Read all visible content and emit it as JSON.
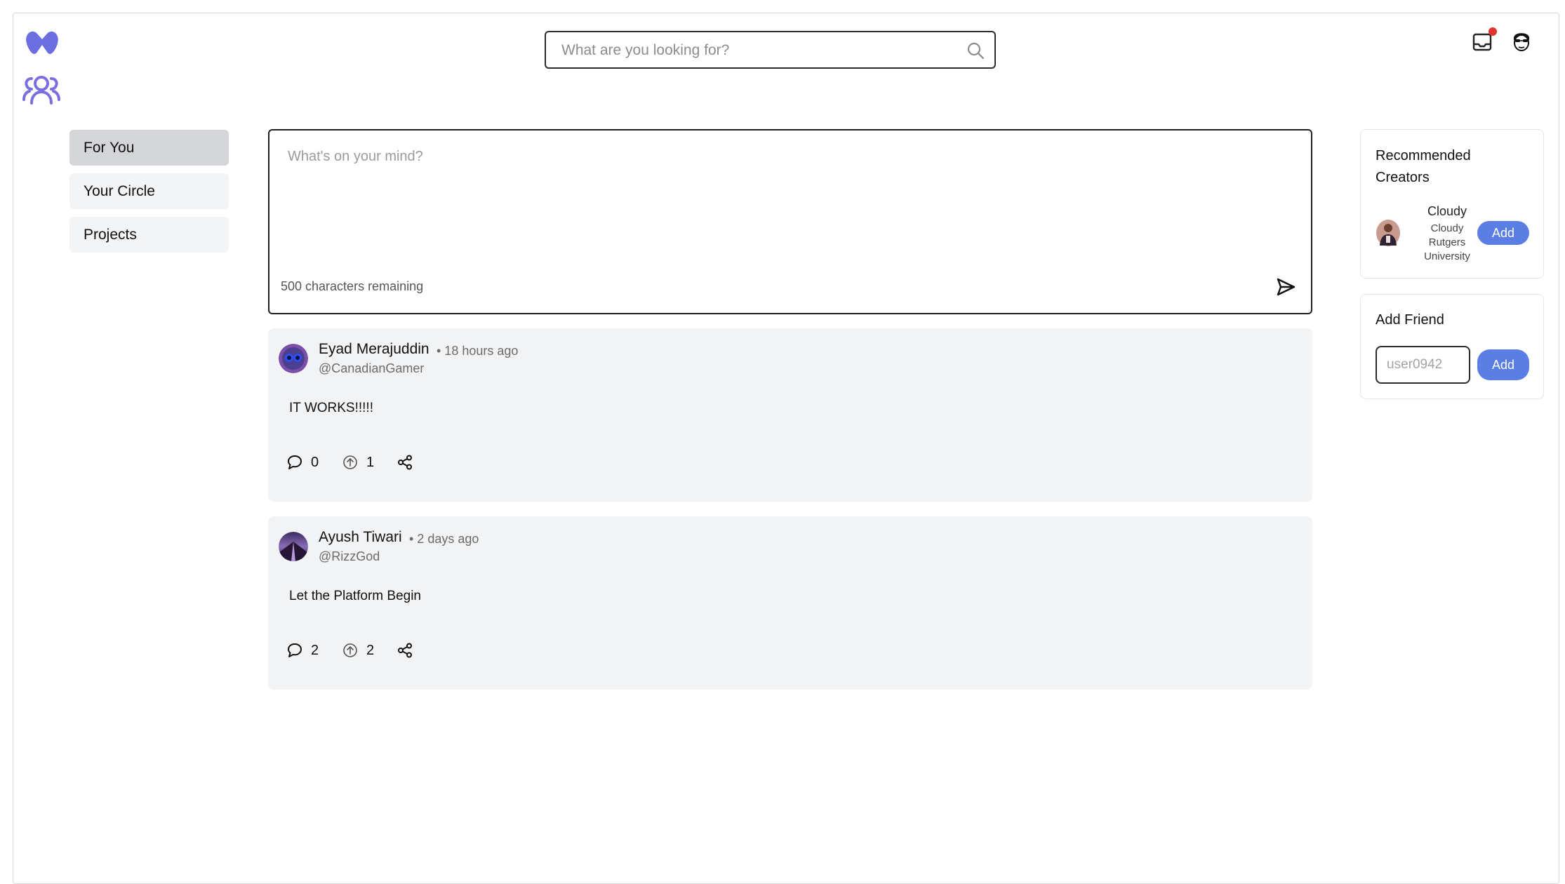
{
  "header": {
    "search": {
      "placeholder": "What are you looking for?"
    },
    "inbox_has_notification": true,
    "icons": [
      "logo-icon",
      "friends-icon",
      "search-icon",
      "inbox-icon",
      "user-avatar"
    ]
  },
  "nav": {
    "items": [
      {
        "label": "For You",
        "active": true
      },
      {
        "label": "Your Circle",
        "active": false
      },
      {
        "label": "Projects",
        "active": false
      }
    ]
  },
  "composer": {
    "placeholder": "What's on your mind?",
    "remaining": "500 characters remaining"
  },
  "posts": [
    {
      "author": "Eyad Merajuddin",
      "time": "• 18 hours ago",
      "handle": "@CanadianGamer",
      "body": "IT WORKS!!!!!",
      "comments": "0",
      "upvotes": "1"
    },
    {
      "author": "Ayush Tiwari",
      "time": "• 2 days ago",
      "handle": "@RizzGod",
      "body": "Let the Platform Begin",
      "comments": "2",
      "upvotes": "2"
    }
  ],
  "recommended": {
    "title": "Recommended Creators",
    "creators": [
      {
        "name": "Cloudy",
        "subtitle": "Cloudy",
        "school_line1": "Rutgers",
        "school_line2": "University",
        "button": "Add"
      }
    ]
  },
  "add_friend": {
    "title": "Add Friend",
    "placeholder": "user0942",
    "button": "Add"
  },
  "colors": {
    "accent": "#5b7ee5",
    "logo": "#6b6ee0",
    "notification": "#e0342c",
    "post_bg": "#f2f3f5",
    "nav_active": "#d4d5d8"
  }
}
